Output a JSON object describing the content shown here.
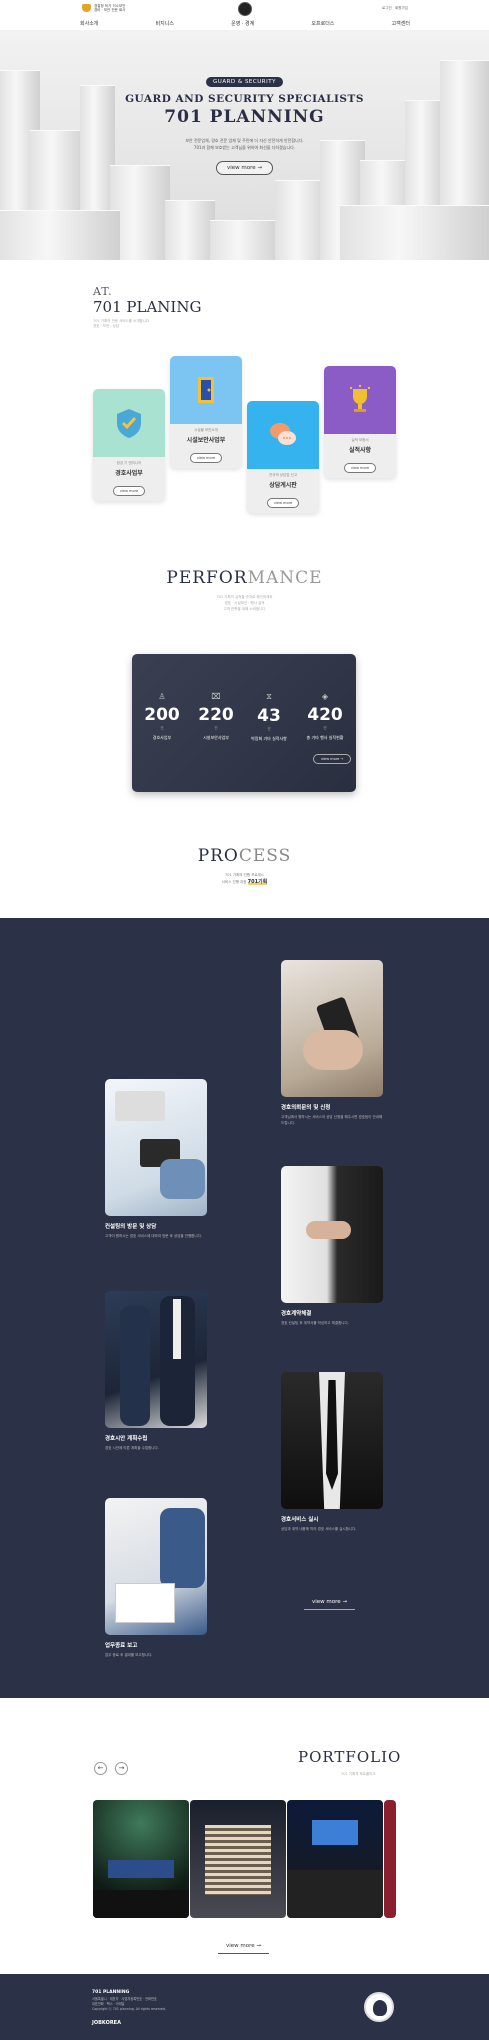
{
  "header": {
    "logo_text": "경찰청 허가 701보안\n경비 · 보안 전문 회사",
    "top_links": "로그인 · 회원가입",
    "nav": [
      "회사소개",
      "비지니스",
      "운영 · 경계",
      "오프로더스",
      "고객센터"
    ]
  },
  "hero": {
    "badge": "GUARD & SECURITY",
    "title_line1": "GUARD AND SECURITY SPECIALISTS",
    "title_line2": "701 PLANNING",
    "desc_line1": "보안 전문업체, 경호 전문 업체 및 주민에 더 자신 안전하게 안전합니다.",
    "desc_line2": "701과 함께 보호받는 고객님을 위하여 최선을 다하겠습니다.",
    "button": "view more"
  },
  "about": {
    "at": "AT.",
    "name": "701 PLANING",
    "sub_line1": "701 기획의 전문 서비스를 소개합니다",
    "sub_line2": "경호 · 보안 · 상담",
    "cards": [
      {
        "caption": "정성 기 엔지니어",
        "title": "경호사업부",
        "button": "view more",
        "color": "#a9e2d0"
      },
      {
        "caption": "시설물 보안소개",
        "title": "시설보안사업부",
        "button": "view more",
        "color": "#7cc5f2"
      },
      {
        "caption": "전국적 상담업 신고",
        "title": "상담게시판",
        "button": "view more",
        "color": "#34b3ef"
      },
      {
        "caption": "실적 보증서",
        "title": "실적사항",
        "button": "view more",
        "color": "#8b5bc6"
      }
    ]
  },
  "performance": {
    "title_dark": "PERFOR",
    "title_light": "MANCE",
    "sub_line1": "701 기획의 실적을 숫자로 확인하세요",
    "sub_line2": "경호 · 시설보안 · 행사 실적",
    "sub_line3": "고객 만족을 위해 노력합니다",
    "stats": [
      {
        "icon": "users-icon",
        "glyph": "♙",
        "num": "200",
        "unit": "건",
        "label": "경호사업부"
      },
      {
        "icon": "camera-off-icon",
        "glyph": "⌧",
        "num": "220",
        "unit": "건",
        "label": "시설보안사업부"
      },
      {
        "icon": "hourglass-icon",
        "glyph": "⧖",
        "num": "43",
        "unit": "건",
        "label": "박람회 기타 실적사항"
      },
      {
        "icon": "layers-icon",
        "glyph": "◈",
        "num": "420",
        "unit": "건",
        "label": "총 기타 행사 실적현황"
      }
    ],
    "button": "view more"
  },
  "process": {
    "title_dark": "PRO",
    "title_light": "CESS",
    "sub_line1": "701 기획의 진행 프로세스",
    "sub_line2_prefix": "서비스 진행 과정",
    "sub_highlight": "701기획",
    "steps": [
      {
        "title": "경호의뢰문의 및 신청",
        "desc": "고객님께서 원하시는 서비스의 상담 신청을 해주시면 경호팀이 안내해 드립니다."
      },
      {
        "title": "컨설팅의 방문 및 상담",
        "desc": "고객이 원하시는 경호 서비스에 대하여 방문 후 상담을 진행합니다."
      },
      {
        "title": "경호계약체결",
        "desc": "경호 컨설팅 후 계약서를 작성하고 체결합니다."
      },
      {
        "title": "경호시안 계획수립",
        "desc": "경호 시안에 따른 계획을 수립합니다."
      },
      {
        "title": "경호서비스 실시",
        "desc": "상담과 계약 내용에 따라 경호 서비스를 실시합니다."
      },
      {
        "title": "업무종료 보고",
        "desc": "업무 종료 후 결과를 보고합니다."
      }
    ],
    "button": "view more"
  },
  "portfolio": {
    "title": "PORTFOLIO",
    "sub": "701 기획의 포트폴리오",
    "button": "view more"
  },
  "footer": {
    "title": "701 PLANNING",
    "info_line1": "서울특별시 · 대표자 · 사업자등록번호 · 전화번호",
    "info_line2": "대표전화 · 팩스 · 이메일",
    "info_line3": "Copyright ⓒ 701 planning. All rights reserved.",
    "brand": "JOBKOREA"
  },
  "colors": {
    "navy": "#2b3147",
    "accent": "#f1d16d"
  }
}
